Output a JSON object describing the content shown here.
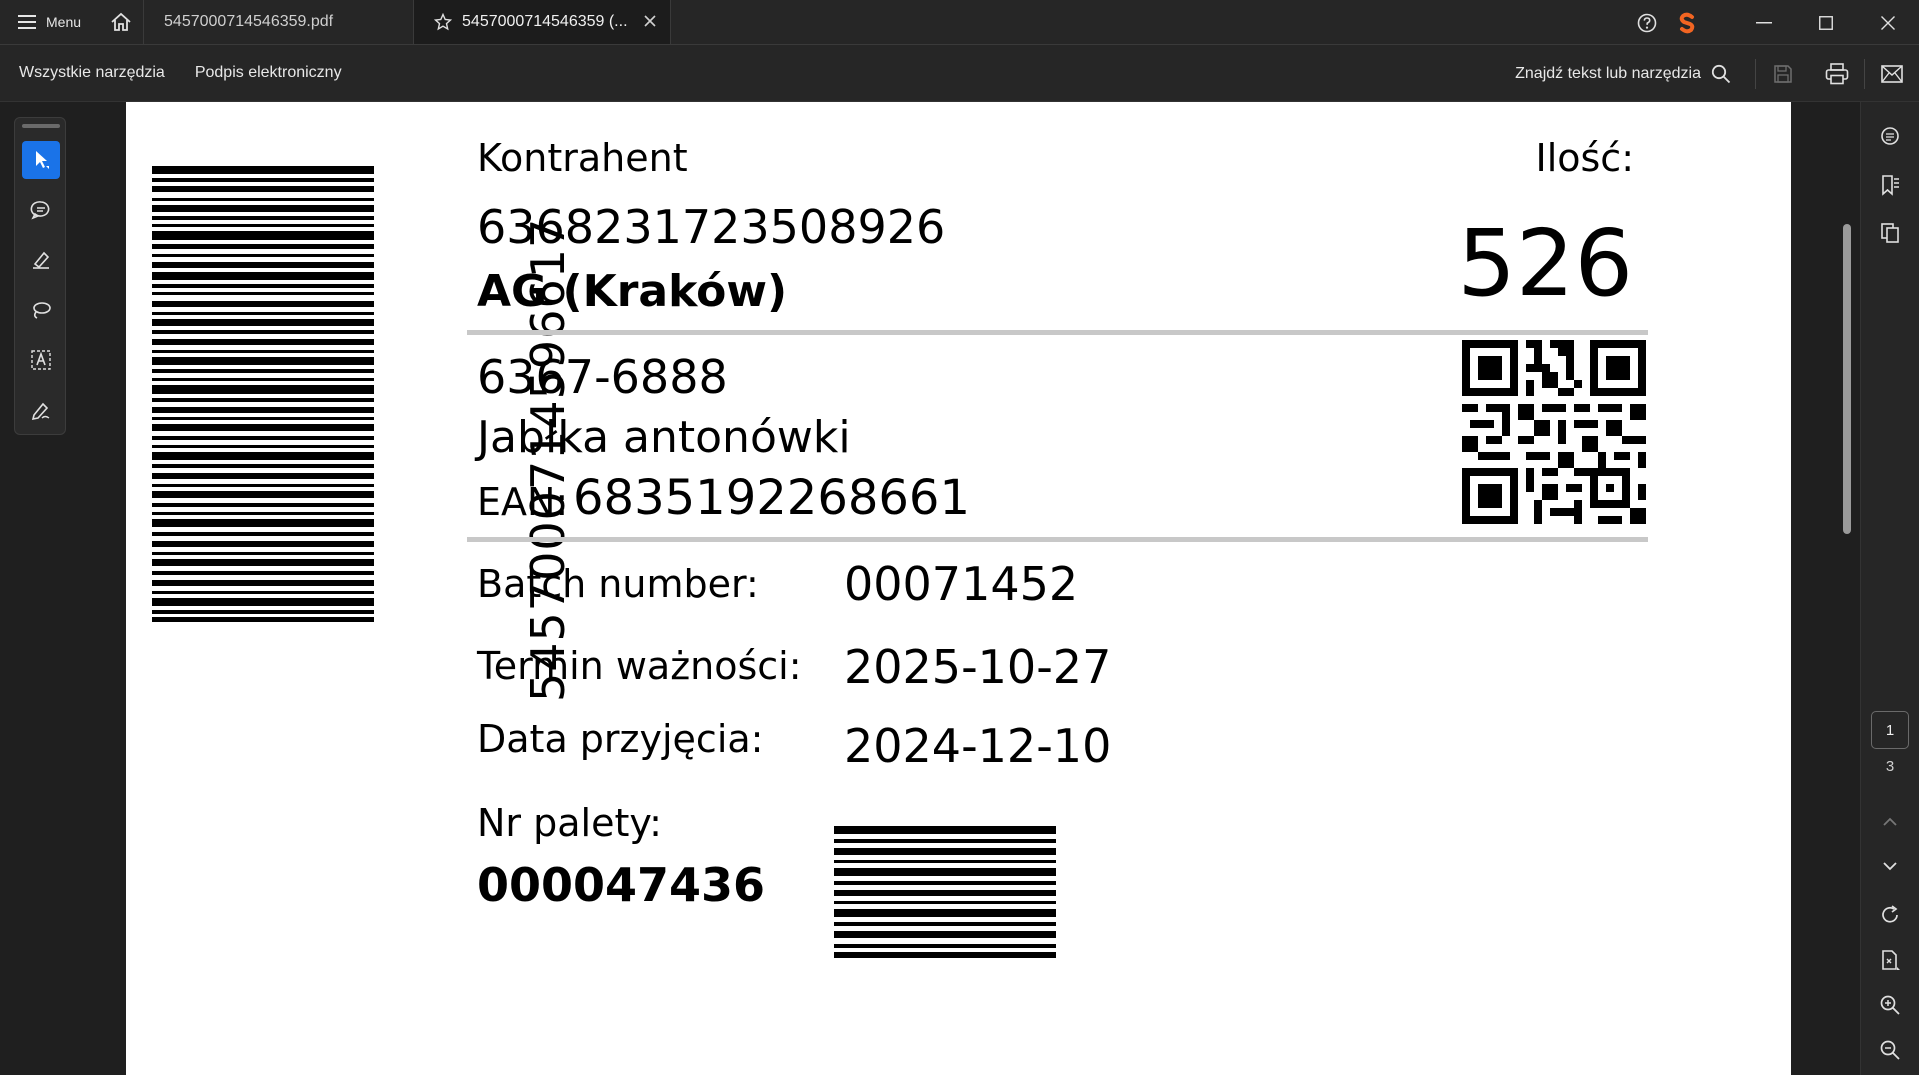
{
  "titlebar": {
    "menu_label": "Menu",
    "tabs": [
      {
        "label": "5457000714546359.pdf",
        "active": false
      },
      {
        "label": "5457000714546359 (...",
        "active": true
      }
    ]
  },
  "toolbar": {
    "all_tools": "Wszystkie narzędzia",
    "e_signature": "Podpis elektroniczny",
    "search": "Znajdź tekst lub narzędzia"
  },
  "page_nav": {
    "current": "1",
    "total": "3"
  },
  "label": {
    "vertical_code": "5457000714596617",
    "contractor_label": "Kontrahent",
    "contractor_code": "6368231723508926",
    "contractor_name": "AG (Kraków)",
    "quantity_label": "Ilość:",
    "quantity_value": "526",
    "product_code": "6367-6888",
    "product_name": "Jabłka antonówki",
    "ean_label": "EAN:",
    "ean_value": "6835192268661",
    "batch_label": "Batch number:",
    "batch_value": "00071452",
    "expiry_label": "Termin ważności:",
    "expiry_value": "2025-10-27",
    "received_label": "Data przyjęcia:",
    "received_value": "2024-12-10",
    "pallet_label": "Nr palety:",
    "pallet_value": "000047436"
  },
  "colors": {
    "accent": "#1a73e8",
    "chrome_bg": "#262626",
    "logo": "#f26522"
  }
}
